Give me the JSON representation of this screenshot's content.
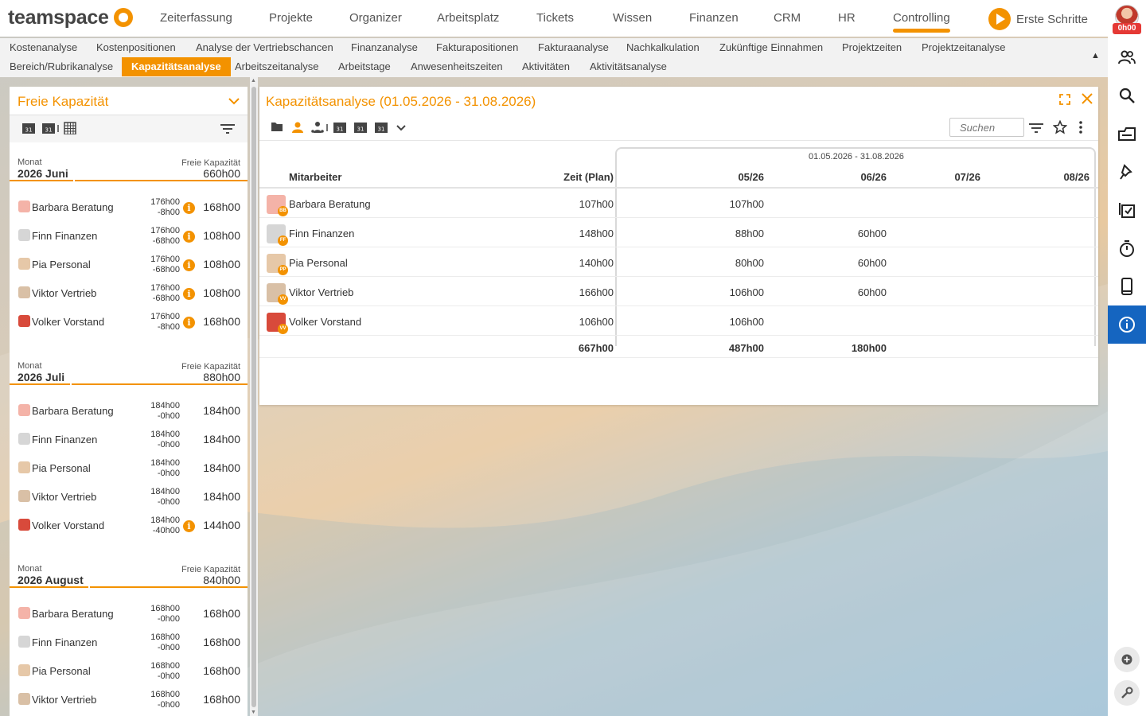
{
  "app": {
    "logo": "teamspace",
    "nav": [
      "Zeiterfassung",
      "Projekte",
      "Organizer",
      "Arbeitsplatz",
      "Tickets",
      "Wissen",
      "Finanzen",
      "CRM",
      "HR",
      "Controlling"
    ],
    "active_nav": "Controlling",
    "start_label": "Erste Schritte",
    "timer": "0h00"
  },
  "subnav": {
    "row1": [
      "Kostenanalyse",
      "Kostenpositionen",
      "Analyse der Vertriebschancen",
      "Finanzanalyse",
      "Fakturapositionen",
      "Fakturaanalyse",
      "Nachkalkulation",
      "Zukünftige Einnahmen",
      "Projektzeiten",
      "Projektzeitanalyse"
    ],
    "row2": [
      "Bereich/Rubrikanalyse",
      "Kapazitätsanalyse",
      "Arbeitszeitanalyse",
      "Arbeitstage",
      "Anwesenheitszeiten",
      "Aktivitäten",
      "Aktivitätsanalyse"
    ],
    "active": "Kapazitätsanalyse"
  },
  "right_sidebar": {
    "icons": [
      "people-icon",
      "search-icon",
      "inbox-icon",
      "pin-icon",
      "checklist-icon",
      "stopwatch-icon",
      "mobile-icon",
      "info-icon"
    ],
    "bottom_icons": [
      "add-circle-icon",
      "wrench-icon"
    ],
    "active_color": "#1565c0"
  },
  "left_panel": {
    "title": "Freie Kapazität",
    "toolbar_icons": [
      "calendar-week-icon",
      "calendar-month-icon",
      "calendar-grid-icon",
      "filter-icon"
    ],
    "month_label": "Monat",
    "free_label": "Freie Kapazität",
    "months": [
      {
        "month": "2026 Juni",
        "free": "660h00",
        "people": [
          {
            "name": "Barbara Beratung",
            "cap": "176h00",
            "delta": "-8h00",
            "warn": true,
            "free": "168h00"
          },
          {
            "name": "Finn Finanzen",
            "cap": "176h00",
            "delta": "-68h00",
            "warn": true,
            "free": "108h00"
          },
          {
            "name": "Pia Personal",
            "cap": "176h00",
            "delta": "-68h00",
            "warn": true,
            "free": "108h00"
          },
          {
            "name": "Viktor Vertrieb",
            "cap": "176h00",
            "delta": "-68h00",
            "warn": true,
            "free": "108h00"
          },
          {
            "name": "Volker Vorstand",
            "cap": "176h00",
            "delta": "-8h00",
            "warn": true,
            "free": "168h00"
          }
        ]
      },
      {
        "month": "2026 Juli",
        "free": "880h00",
        "people": [
          {
            "name": "Barbara Beratung",
            "cap": "184h00",
            "delta": "-0h00",
            "warn": false,
            "free": "184h00"
          },
          {
            "name": "Finn Finanzen",
            "cap": "184h00",
            "delta": "-0h00",
            "warn": false,
            "free": "184h00"
          },
          {
            "name": "Pia Personal",
            "cap": "184h00",
            "delta": "-0h00",
            "warn": false,
            "free": "184h00"
          },
          {
            "name": "Viktor Vertrieb",
            "cap": "184h00",
            "delta": "-0h00",
            "warn": false,
            "free": "184h00"
          },
          {
            "name": "Volker Vorstand",
            "cap": "184h00",
            "delta": "-40h00",
            "warn": true,
            "free": "144h00"
          }
        ]
      },
      {
        "month": "2026 August",
        "free": "840h00",
        "people": [
          {
            "name": "Barbara Beratung",
            "cap": "168h00",
            "delta": "-0h00",
            "warn": false,
            "free": "168h00"
          },
          {
            "name": "Finn Finanzen",
            "cap": "168h00",
            "delta": "-0h00",
            "warn": false,
            "free": "168h00"
          },
          {
            "name": "Pia Personal",
            "cap": "168h00",
            "delta": "-0h00",
            "warn": false,
            "free": "168h00"
          },
          {
            "name": "Viktor Vertrieb",
            "cap": "168h00",
            "delta": "-0h00",
            "warn": false,
            "free": "168h00"
          }
        ]
      }
    ]
  },
  "main_panel": {
    "title": "Kapazitätsanalyse (01.05.2026 - 31.08.2026)",
    "search_placeholder": "Suchen",
    "period": "01.05.2026 - 31.08.2026",
    "columns": [
      "Mitarbeiter",
      "Zeit (Plan)",
      "05/26",
      "06/26",
      "07/26",
      "08/26"
    ],
    "rows": [
      {
        "name": "Barbara Beratung",
        "initials": "BB",
        "plan": "107h00",
        "m05": "107h00",
        "m06": "",
        "m07": "",
        "m08": ""
      },
      {
        "name": "Finn Finanzen",
        "initials": "FF",
        "plan": "148h00",
        "m05": "88h00",
        "m06": "60h00",
        "m07": "",
        "m08": ""
      },
      {
        "name": "Pia Personal",
        "initials": "PP",
        "plan": "140h00",
        "m05": "80h00",
        "m06": "60h00",
        "m07": "",
        "m08": ""
      },
      {
        "name": "Viktor Vertrieb",
        "initials": "VV",
        "plan": "166h00",
        "m05": "106h00",
        "m06": "60h00",
        "m07": "",
        "m08": ""
      },
      {
        "name": "Volker Vorstand",
        "initials": "VV",
        "plan": "106h00",
        "m05": "106h00",
        "m06": "",
        "m07": "",
        "m08": ""
      }
    ],
    "totals": {
      "plan": "667h00",
      "m05": "487h00",
      "m06": "180h00",
      "m07": "",
      "m08": ""
    }
  },
  "colors": {
    "accent": "#f39200",
    "info_active": "#1565c0",
    "timer_badge": "#e53935"
  }
}
